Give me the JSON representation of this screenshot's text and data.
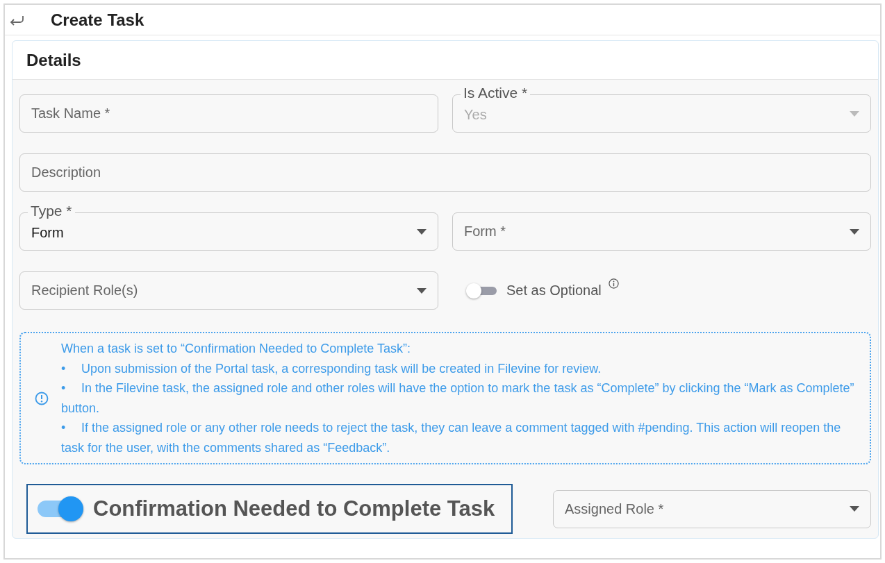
{
  "header": {
    "title": "Create Task"
  },
  "section": {
    "title": "Details"
  },
  "rows": [
    {
      "items": [
        {
          "kind": "text",
          "placeholder": "Task Name *"
        },
        {
          "kind": "select",
          "label": "Is Active *",
          "value": "Yes",
          "disabled": true
        }
      ]
    },
    {
      "items": [
        {
          "kind": "text",
          "placeholder": "Description"
        }
      ]
    },
    {
      "items": [
        {
          "kind": "select",
          "label": "Type *",
          "value": "Form",
          "disabled": false
        },
        {
          "kind": "select",
          "placeholder": "Form *"
        }
      ]
    },
    {
      "items": [
        {
          "kind": "select",
          "placeholder": "Recipient Role(s)"
        },
        {
          "kind": "toggle",
          "label": "Set as Optional",
          "on": false,
          "highlighted": false,
          "info": true
        }
      ]
    }
  ],
  "note": {
    "intro": "When a task is set to “Confirmation Needed to Complete Task”:",
    "bullets": [
      "Upon submission of the Portal task, a corresponding task will be created in Filevine for review.",
      "In the Filevine task, the assigned role and other roles will have the option to mark the task as “Complete” by clicking the “Mark as Complete” button.",
      "If the assigned role or any other role needs to reject the task, they can leave a comment tagged with #pending. This action will reopen the task for the user, with the comments shared as “Feedback”."
    ],
    "bullet_char": "•"
  },
  "bottom": {
    "items": [
      {
        "kind": "toggle",
        "label": "Confirmation Needed to Complete Task",
        "on": true,
        "highlighted": true,
        "info": false
      },
      {
        "kind": "select",
        "placeholder": "Assigned Role *"
      }
    ]
  }
}
